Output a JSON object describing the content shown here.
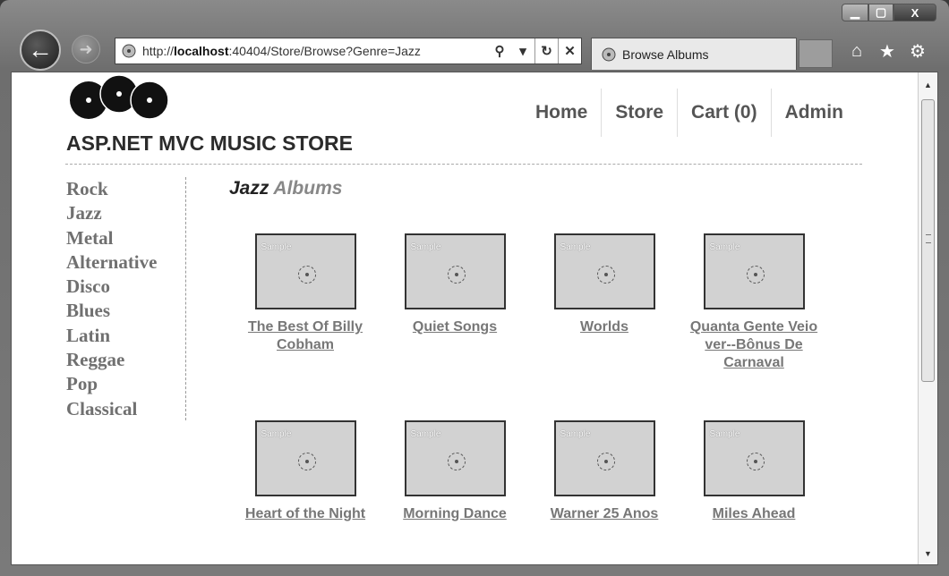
{
  "browser": {
    "url_prefix": "http://",
    "url_host": "localhost",
    "url_rest": ":40404/Store/Browse?Genre=Jazz",
    "tab_title": "Browse Albums",
    "window_controls": {
      "minimize": "▁",
      "maximize": "▢",
      "close": "X"
    }
  },
  "site": {
    "title": "ASP.NET MVC MUSIC STORE",
    "nav": [
      "Home",
      "Store",
      "Cart (0)",
      "Admin"
    ]
  },
  "genres": [
    "Rock",
    "Jazz",
    "Metal",
    "Alternative",
    "Disco",
    "Blues",
    "Latin",
    "Reggae",
    "Pop",
    "Classical"
  ],
  "section": {
    "genre": "Jazz",
    "suffix": "Albums"
  },
  "albums": [
    {
      "title": "The Best Of Billy Cobham",
      "art_label": "Sample"
    },
    {
      "title": "Quiet Songs",
      "art_label": "Sample"
    },
    {
      "title": "Worlds",
      "art_label": "Sample"
    },
    {
      "title": "Quanta Gente Veio ver--Bônus De Carnaval",
      "art_label": "Sample"
    },
    {
      "title": "Heart of the Night",
      "art_label": "Sample"
    },
    {
      "title": "Morning Dance",
      "art_label": "Sample"
    },
    {
      "title": "Warner 25 Anos",
      "art_label": "Sample"
    },
    {
      "title": "Miles Ahead",
      "art_label": "Sample"
    }
  ]
}
